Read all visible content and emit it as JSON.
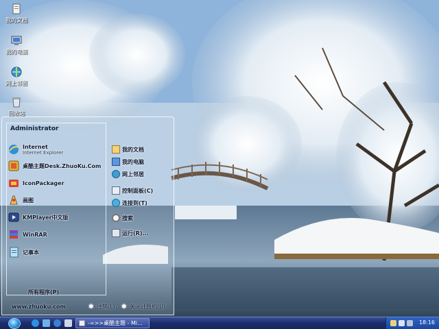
{
  "desktop": {
    "icons": [
      {
        "label": "我的文档",
        "icon": "my-documents-icon"
      },
      {
        "label": "我的电脑",
        "icon": "my-computer-icon"
      },
      {
        "label": "网上邻居",
        "icon": "network-places-icon"
      },
      {
        "label": "回收站",
        "icon": "recycle-bin-icon"
      }
    ]
  },
  "start_menu": {
    "user": "Administrator",
    "programs": [
      {
        "label": "Internet",
        "sublabel": "Internet Explorer",
        "icon": "internet-explorer-icon"
      },
      {
        "label": "桌酷主题Desk.ZhuoKu.Com",
        "icon": "zhuoku-theme-icon"
      },
      {
        "label": "IconPackager",
        "icon": "iconpackager-icon"
      },
      {
        "label": "画图",
        "icon": "paint-icon"
      },
      {
        "label": "KMPlayer中文版",
        "icon": "kmplayer-icon"
      },
      {
        "label": "WinRAR",
        "icon": "winrar-icon"
      },
      {
        "label": "记事本",
        "icon": "notepad-icon"
      }
    ],
    "all_programs": "所有程序(P)",
    "places": [
      {
        "label": "我的文档",
        "icon": "folder-icon"
      },
      {
        "label": "我的电脑",
        "icon": "computer-icon"
      },
      {
        "label": "网上邻居",
        "icon": "network-icon"
      },
      {
        "label": "控制面板(C)",
        "icon": "control-panel-icon"
      },
      {
        "label": "连接到(T)",
        "icon": "connect-icon"
      },
      {
        "label": "搜索",
        "icon": "search-icon"
      },
      {
        "label": "运行(R)...",
        "icon": "run-icon"
      }
    ],
    "site": "www.zhuoku.com",
    "logoff": "注销(L)",
    "shutdown": "关闭计算机(U)"
  },
  "taskbar": {
    "task_label": "-=>>桌酷主题 - Mi...",
    "clock": "18:16"
  }
}
